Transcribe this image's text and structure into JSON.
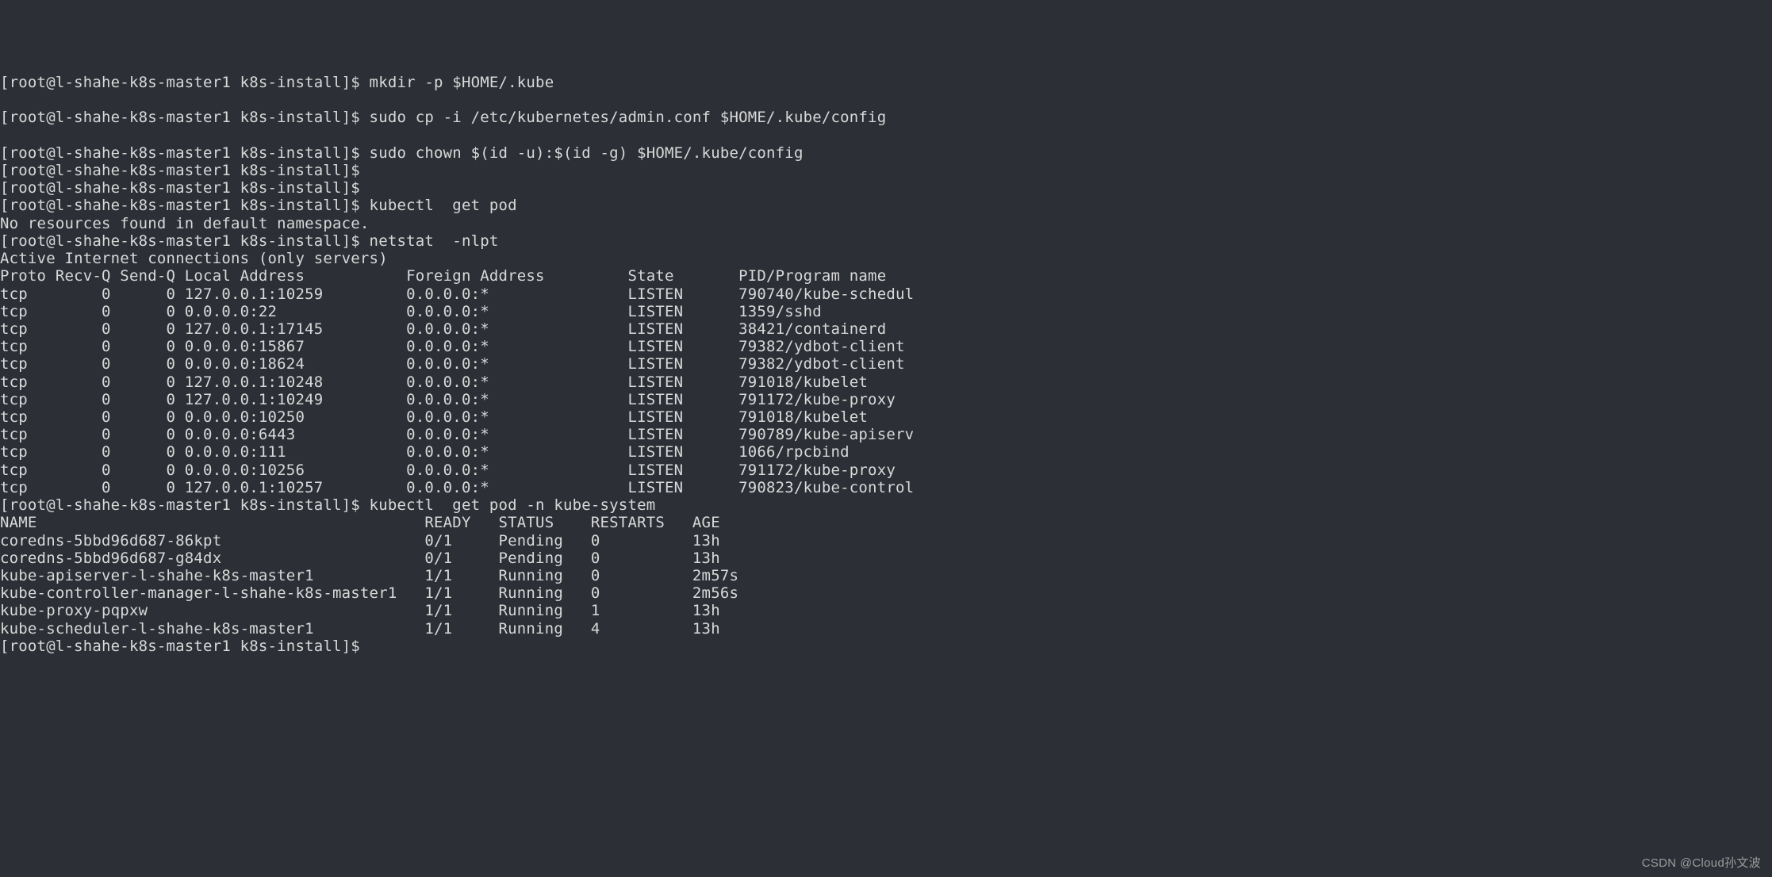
{
  "prompt": "[root@l-shahe-k8s-master1 k8s-install]$",
  "commands": {
    "mkdir": "mkdir -p $HOME/.kube",
    "cp": "sudo cp -i /etc/kubernetes/admin.conf $HOME/.kube/config",
    "chown": "sudo chown $(id -u):$(id -g) $HOME/.kube/config",
    "getpod": "kubectl  get pod",
    "netstat": "netstat  -nlpt",
    "getpod_system": "kubectl  get pod -n kube-system"
  },
  "messages": {
    "no_resources": "No resources found in default namespace.",
    "active_connections": "Active Internet connections (only servers)"
  },
  "netstat": {
    "header": {
      "proto": "Proto",
      "recvq": "Recv-Q",
      "sendq": "Send-Q",
      "local": "Local Address",
      "foreign": "Foreign Address",
      "state": "State",
      "pid": "PID/Program name"
    },
    "rows": [
      {
        "proto": "tcp",
        "recvq": "0",
        "sendq": "0",
        "local": "127.0.0.1:10259",
        "foreign": "0.0.0.0:*",
        "state": "LISTEN",
        "pid": "790740/kube-schedul"
      },
      {
        "proto": "tcp",
        "recvq": "0",
        "sendq": "0",
        "local": "0.0.0.0:22",
        "foreign": "0.0.0.0:*",
        "state": "LISTEN",
        "pid": "1359/sshd"
      },
      {
        "proto": "tcp",
        "recvq": "0",
        "sendq": "0",
        "local": "127.0.0.1:17145",
        "foreign": "0.0.0.0:*",
        "state": "LISTEN",
        "pid": "38421/containerd"
      },
      {
        "proto": "tcp",
        "recvq": "0",
        "sendq": "0",
        "local": "0.0.0.0:15867",
        "foreign": "0.0.0.0:*",
        "state": "LISTEN",
        "pid": "79382/ydbot-client"
      },
      {
        "proto": "tcp",
        "recvq": "0",
        "sendq": "0",
        "local": "0.0.0.0:18624",
        "foreign": "0.0.0.0:*",
        "state": "LISTEN",
        "pid": "79382/ydbot-client"
      },
      {
        "proto": "tcp",
        "recvq": "0",
        "sendq": "0",
        "local": "127.0.0.1:10248",
        "foreign": "0.0.0.0:*",
        "state": "LISTEN",
        "pid": "791018/kubelet"
      },
      {
        "proto": "tcp",
        "recvq": "0",
        "sendq": "0",
        "local": "127.0.0.1:10249",
        "foreign": "0.0.0.0:*",
        "state": "LISTEN",
        "pid": "791172/kube-proxy"
      },
      {
        "proto": "tcp",
        "recvq": "0",
        "sendq": "0",
        "local": "0.0.0.0:10250",
        "foreign": "0.0.0.0:*",
        "state": "LISTEN",
        "pid": "791018/kubelet"
      },
      {
        "proto": "tcp",
        "recvq": "0",
        "sendq": "0",
        "local": "0.0.0.0:6443",
        "foreign": "0.0.0.0:*",
        "state": "LISTEN",
        "pid": "790789/kube-apiserv"
      },
      {
        "proto": "tcp",
        "recvq": "0",
        "sendq": "0",
        "local": "0.0.0.0:111",
        "foreign": "0.0.0.0:*",
        "state": "LISTEN",
        "pid": "1066/rpcbind"
      },
      {
        "proto": "tcp",
        "recvq": "0",
        "sendq": "0",
        "local": "0.0.0.0:10256",
        "foreign": "0.0.0.0:*",
        "state": "LISTEN",
        "pid": "791172/kube-proxy"
      },
      {
        "proto": "tcp",
        "recvq": "0",
        "sendq": "0",
        "local": "127.0.0.1:10257",
        "foreign": "0.0.0.0:*",
        "state": "LISTEN",
        "pid": "790823/kube-control"
      }
    ]
  },
  "pods": {
    "header": {
      "name": "NAME",
      "ready": "READY",
      "status": "STATUS",
      "restarts": "RESTARTS",
      "age": "AGE"
    },
    "rows": [
      {
        "name": "coredns-5bbd96d687-86kpt",
        "ready": "0/1",
        "status": "Pending",
        "restarts": "0",
        "age": "13h"
      },
      {
        "name": "coredns-5bbd96d687-g84dx",
        "ready": "0/1",
        "status": "Pending",
        "restarts": "0",
        "age": "13h"
      },
      {
        "name": "kube-apiserver-l-shahe-k8s-master1",
        "ready": "1/1",
        "status": "Running",
        "restarts": "0",
        "age": "2m57s"
      },
      {
        "name": "kube-controller-manager-l-shahe-k8s-master1",
        "ready": "1/1",
        "status": "Running",
        "restarts": "0",
        "age": "2m56s"
      },
      {
        "name": "kube-proxy-pqpxw",
        "ready": "1/1",
        "status": "Running",
        "restarts": "1",
        "age": "13h"
      },
      {
        "name": "kube-scheduler-l-shahe-k8s-master1",
        "ready": "1/1",
        "status": "Running",
        "restarts": "4",
        "age": "13h"
      }
    ]
  },
  "watermark": "CSDN @Cloud孙文波"
}
